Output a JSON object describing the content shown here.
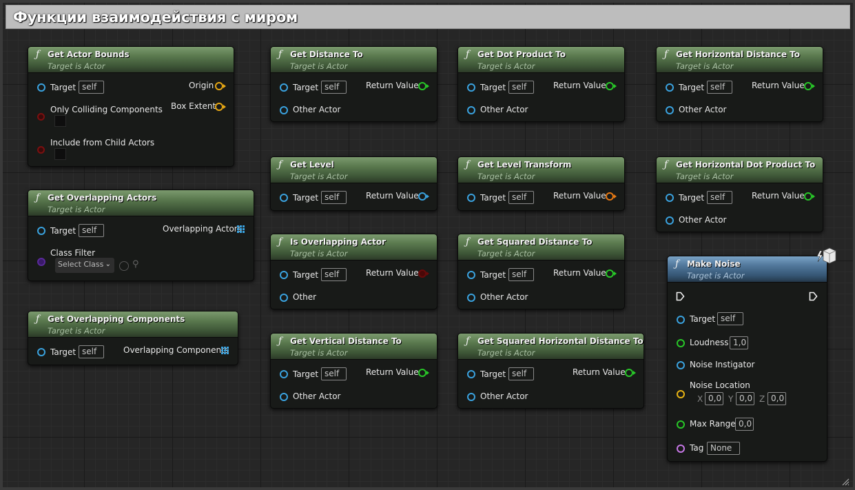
{
  "comment": {
    "title": "Функции взаимодействия с миром"
  },
  "common": {
    "target_subtitle": "Target is Actor",
    "target_label": "Target",
    "self": "self",
    "return_value": "Return Value",
    "other_actor": "Other Actor",
    "function_icon": "ƒ"
  },
  "nodes": {
    "get_actor_bounds": {
      "title": "Get Actor Bounds",
      "origin": "Origin",
      "box_extent": "Box Extent",
      "only_colliding": "Only Colliding Components",
      "include_child": "Include from Child Actors"
    },
    "get_overlapping_actors": {
      "title": "Get Overlapping Actors",
      "output": "Overlapping Actors",
      "class_filter": "Class Filter",
      "select_class": "Select Class"
    },
    "get_overlapping_components": {
      "title": "Get Overlapping Components",
      "output": "Overlapping Components"
    },
    "get_distance_to": {
      "title": "Get Distance To"
    },
    "get_level": {
      "title": "Get Level"
    },
    "is_overlapping_actor": {
      "title": "Is Overlapping Actor",
      "other": "Other"
    },
    "get_vertical_distance_to": {
      "title": "Get Vertical Distance To"
    },
    "get_dot_product_to": {
      "title": "Get Dot Product To"
    },
    "get_level_transform": {
      "title": "Get Level Transform"
    },
    "get_squared_distance_to": {
      "title": "Get Squared Distance To"
    },
    "get_squared_horizontal_distance_to": {
      "title": "Get Squared Horizontal Distance To"
    },
    "get_horizontal_distance_to": {
      "title": "Get Horizontal Distance To"
    },
    "get_horizontal_dot_product_to": {
      "title": "Get Horizontal Dot Product To"
    },
    "make_noise": {
      "title": "Make Noise",
      "loudness": "Loudness",
      "loudness_value": "1,0",
      "noise_instigator": "Noise Instigator",
      "noise_location": "Noise Location",
      "x": "X",
      "y": "Y",
      "z": "Z",
      "x_value": "0,0",
      "y_value": "0,0",
      "z_value": "0,0",
      "max_range": "Max Range",
      "max_range_value": "0,0",
      "tag": "Tag",
      "tag_value": "None"
    }
  },
  "colors": {
    "pure_header": "#5b7a4f",
    "impure_header": "#52789c",
    "object_pin": "#3aa3e0",
    "float_pin": "#28c828",
    "vector_pin": "#e8b414",
    "bool_pin": "#7a1010",
    "class_pin": "#5a2a9a",
    "transform_pin": "#e87a14",
    "name_pin": "#c878e8"
  }
}
